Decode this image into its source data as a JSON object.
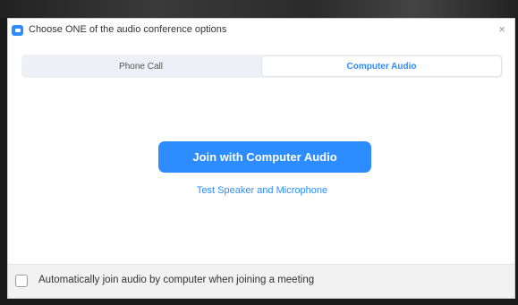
{
  "window": {
    "title": "Choose ONE of the audio conference options",
    "close_glyph": "×",
    "app_icon": "zoom-camera-icon"
  },
  "tabs": [
    {
      "label": "Phone Call",
      "active": false
    },
    {
      "label": "Computer Audio",
      "active": true
    }
  ],
  "main": {
    "join_button_label": "Join with Computer Audio",
    "test_link_label": "Test Speaker and Microphone"
  },
  "footer": {
    "auto_join_label": "Automatically join audio by computer when joining a meeting",
    "auto_join_checked": false
  },
  "colors": {
    "accent": "#2d8cff",
    "tab_bg": "#eef0f5",
    "footer_bg": "#f2f2f2"
  }
}
